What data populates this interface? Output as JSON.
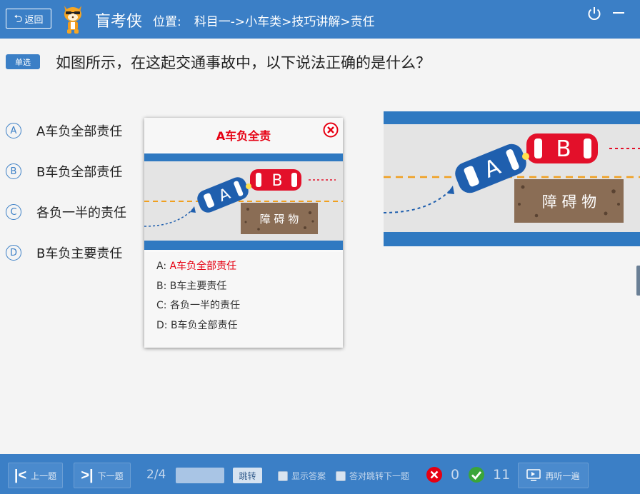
{
  "header": {
    "back_label": "返回",
    "back_icon": "return-arrow-icon",
    "app_title": "盲考侠",
    "location_label": "位置:",
    "location_path": "科目一->小车类>技巧讲解>责任"
  },
  "question": {
    "type_badge": "单选",
    "text": "如图所示，在这起交通事故中，以下说法正确的是什么？"
  },
  "options": [
    {
      "letter": "A",
      "text": "A车负全部责任"
    },
    {
      "letter": "B",
      "text": "B车负全部责任"
    },
    {
      "letter": "C",
      "text": "各负一半的责任"
    },
    {
      "letter": "D",
      "text": "B车负主要责任"
    }
  ],
  "popup": {
    "title": "A车负全责",
    "rows": [
      {
        "key": "A:",
        "value": "A车负全部责任",
        "highlight": true
      },
      {
        "key": "B:",
        "value": "B车主要责任",
        "highlight": false
      },
      {
        "key": "C:",
        "value": "各负一半的责任",
        "highlight": false
      },
      {
        "key": "D:",
        "value": "B车负全部责任",
        "highlight": false
      }
    ]
  },
  "scene": {
    "car_a": "A",
    "car_b": "B",
    "obstacle": "障 碍 物"
  },
  "footer": {
    "prev_label": "上一题",
    "next_label": "下一题",
    "page": "2/4",
    "jump_label": "跳转",
    "show_answer_label": "显示答案",
    "auto_next_label": "答对跳转下一题",
    "wrong_count": "0",
    "right_count": "11",
    "replay_label": "再听一遍"
  },
  "colors": {
    "primary": "#3b7fc6",
    "road_edge": "#2f79c1",
    "car_a": "#1f5fae",
    "car_b": "#e3102a",
    "obstacle": "#8a6d55",
    "highlight": "#e60012",
    "wrong": "#e60012",
    "right": "#3aa53a"
  }
}
